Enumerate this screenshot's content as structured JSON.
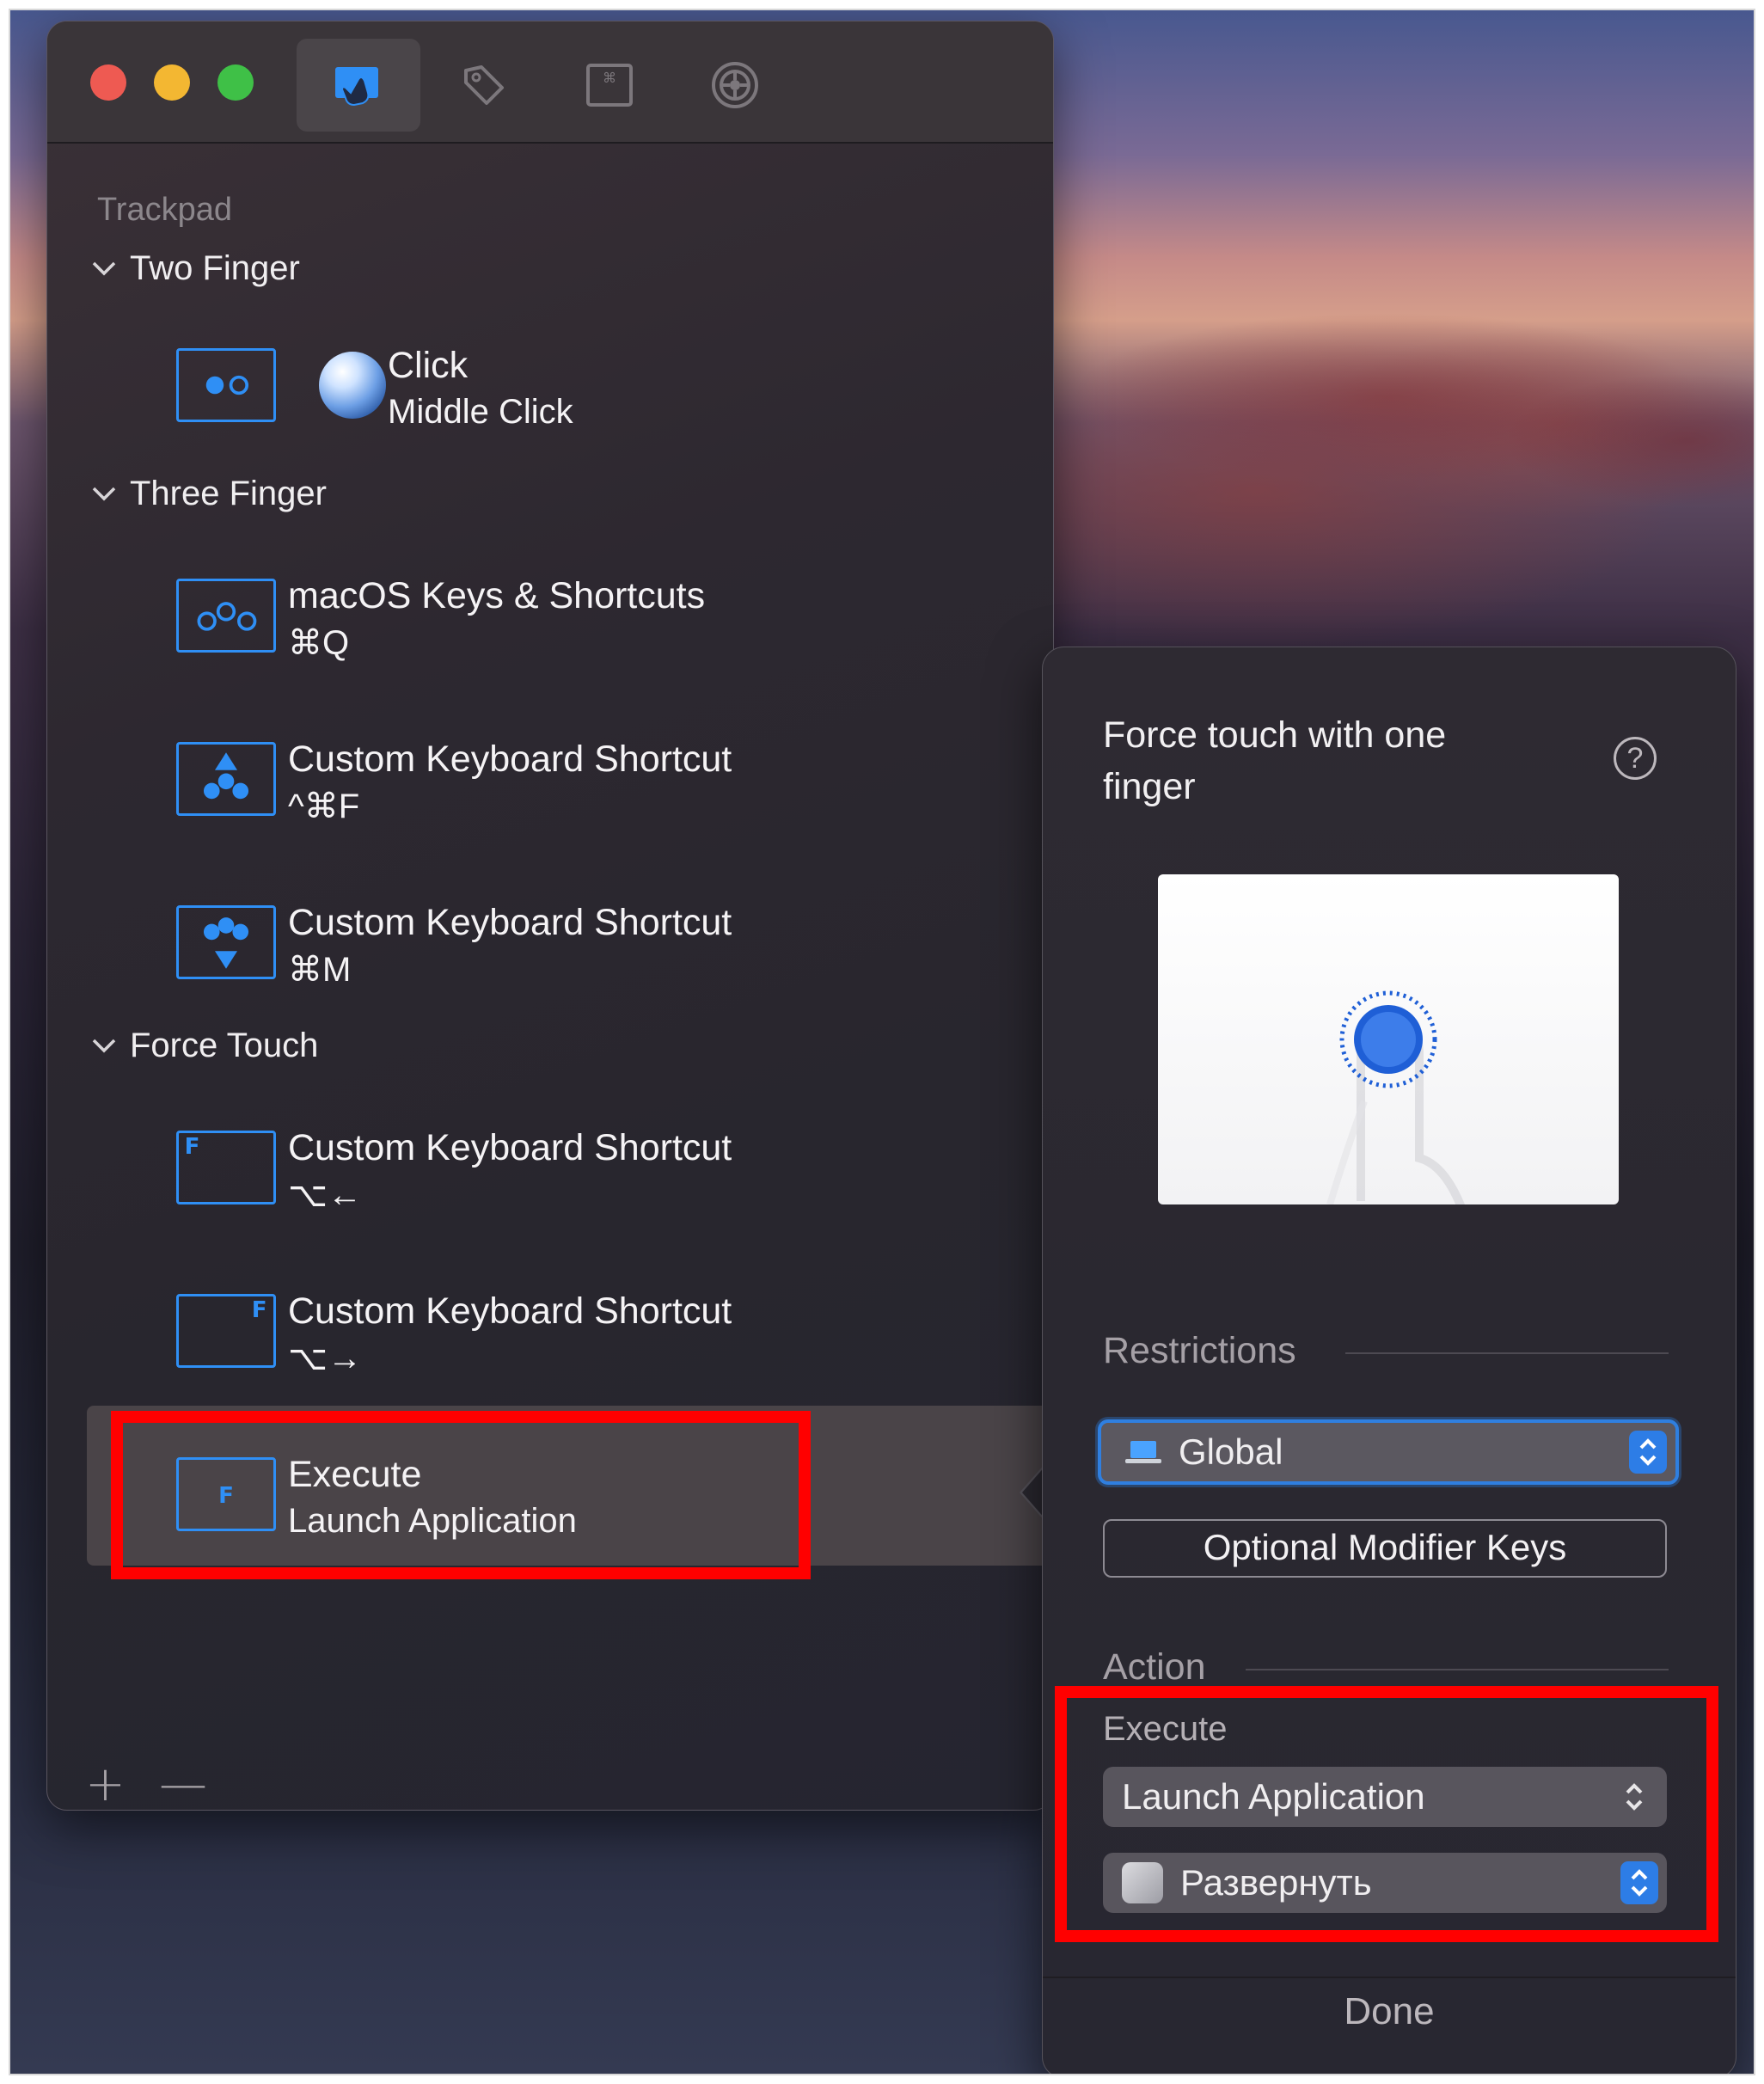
{
  "toolbar": {
    "tabs": [
      {
        "icon": "trackpad-hand-icon",
        "active": true
      },
      {
        "icon": "tag-icon",
        "active": false
      },
      {
        "icon": "keyboard-command-icon",
        "active": false
      },
      {
        "icon": "gear-icon",
        "active": false
      }
    ]
  },
  "sidebar": {
    "section_title": "Trackpad",
    "groups": [
      {
        "title": "Two Finger",
        "items": [
          {
            "gesture_icon": "two-finger-tap-icon",
            "app_icon": "globe-icon",
            "title": "Click",
            "subtitle": "Middle Click"
          }
        ]
      },
      {
        "title": "Three Finger",
        "items": [
          {
            "gesture_icon": "three-finger-tap-icon",
            "title": "macOS Keys & Shortcuts",
            "subtitle": "⌘Q"
          },
          {
            "gesture_icon": "three-finger-swipe-up-icon",
            "title": "Custom Keyboard Shortcut",
            "subtitle": "^⌘F"
          },
          {
            "gesture_icon": "three-finger-swipe-down-icon",
            "title": "Custom Keyboard Shortcut",
            "subtitle": "⌘M"
          }
        ]
      },
      {
        "title": "Force Touch",
        "items": [
          {
            "gesture_icon": "force-touch-top-left-icon",
            "badge": "F",
            "title": "Custom Keyboard Shortcut",
            "subtitle": "⌥←"
          },
          {
            "gesture_icon": "force-touch-top-right-icon",
            "badge": "F",
            "title": "Custom Keyboard Shortcut",
            "subtitle": "⌥→"
          },
          {
            "gesture_icon": "force-touch-center-icon",
            "badge": "F",
            "title": "Execute",
            "subtitle": "Launch Application",
            "selected": true
          }
        ]
      }
    ],
    "add_label": "+",
    "remove_label": "—"
  },
  "popover": {
    "title": "Force touch with one finger",
    "help_label": "?",
    "restrictions": {
      "label": "Restrictions",
      "scope_value": "Global",
      "modifier_button": "Optional Modifier Keys"
    },
    "action": {
      "label": "Action",
      "execute_caption": "Execute",
      "action_value": "Launch Application",
      "application_value": "Развернуть"
    },
    "done_label": "Done"
  },
  "colors": {
    "accent": "#2f8ff5",
    "highlight": "#ff0000",
    "window_bg": "#2b282f"
  }
}
